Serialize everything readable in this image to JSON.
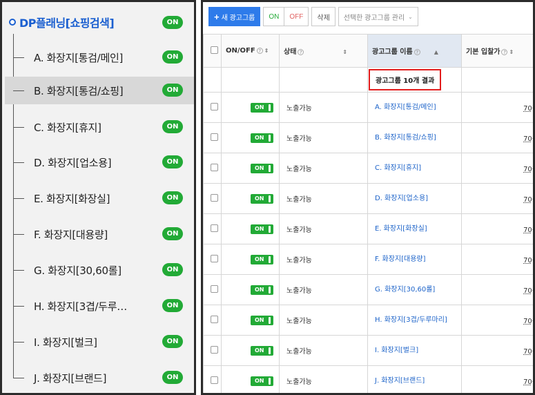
{
  "tree": {
    "root": {
      "label": "DP플래닝[쇼핑검색]",
      "toggle": "ON"
    },
    "items": [
      {
        "label": "A. 화장지[통검/메인]",
        "toggle": "ON"
      },
      {
        "label": "B. 화장지[통검/쇼핑]",
        "toggle": "ON"
      },
      {
        "label": "C. 화장지[휴지]",
        "toggle": "ON"
      },
      {
        "label": "D. 화장지[업소용]",
        "toggle": "ON"
      },
      {
        "label": "E. 화장지[화장실]",
        "toggle": "ON"
      },
      {
        "label": "F. 화장지[대용량]",
        "toggle": "ON"
      },
      {
        "label": "G. 화장지[30,60롤]",
        "toggle": "ON"
      },
      {
        "label": "H. 화장지[3겹/두루…",
        "toggle": "ON"
      },
      {
        "label": "I. 화장지[벌크]",
        "toggle": "ON"
      },
      {
        "label": "J. 화장지[브랜드]",
        "toggle": "ON"
      }
    ]
  },
  "toolbar": {
    "new_label": "새 광고그룹",
    "on_label": "ON",
    "off_label": "OFF",
    "delete_label": "삭제",
    "manage_label": "선택한 광고그룹 관리"
  },
  "table": {
    "headers": {
      "onoff": "ON/OFF",
      "status": "상태",
      "name": "광고그룹 이름",
      "bid": "기본 입찰가"
    },
    "result_text": "광고그룹 10개 결과",
    "rows": [
      {
        "onoff": "ON",
        "status": "노출가능",
        "name": "A. 화장지[통검/메인]",
        "bid_value": "70",
        "bid_unit": "원"
      },
      {
        "onoff": "ON",
        "status": "노출가능",
        "name": "B. 화장지[통검/쇼핑]",
        "bid_value": "70",
        "bid_unit": "원"
      },
      {
        "onoff": "ON",
        "status": "노출가능",
        "name": "C. 화장지[휴지]",
        "bid_value": "70",
        "bid_unit": "원"
      },
      {
        "onoff": "ON",
        "status": "노출가능",
        "name": "D. 화장지[업소용]",
        "bid_value": "70",
        "bid_unit": "원"
      },
      {
        "onoff": "ON",
        "status": "노출가능",
        "name": "E. 화장지[화장실]",
        "bid_value": "70",
        "bid_unit": "원"
      },
      {
        "onoff": "ON",
        "status": "노출가능",
        "name": "F. 화장지[대용량]",
        "bid_value": "70",
        "bid_unit": "원"
      },
      {
        "onoff": "ON",
        "status": "노출가능",
        "name": "G. 화장지[30,60롤]",
        "bid_value": "70",
        "bid_unit": "원"
      },
      {
        "onoff": "ON",
        "status": "노출가능",
        "name": "H. 화장지[3겹/두루마리]",
        "bid_value": "70",
        "bid_unit": "원"
      },
      {
        "onoff": "ON",
        "status": "노출가능",
        "name": "I. 화장지[벌크]",
        "bid_value": "70",
        "bid_unit": "원"
      },
      {
        "onoff": "ON",
        "status": "노출가능",
        "name": "J. 화장지[브랜드]",
        "bid_value": "70",
        "bid_unit": "원"
      }
    ]
  },
  "colors": {
    "accent": "#1a5fd0",
    "toggle_on": "#22aa36",
    "link": "#1c63c9",
    "highlight_border": "#e21c1c"
  }
}
